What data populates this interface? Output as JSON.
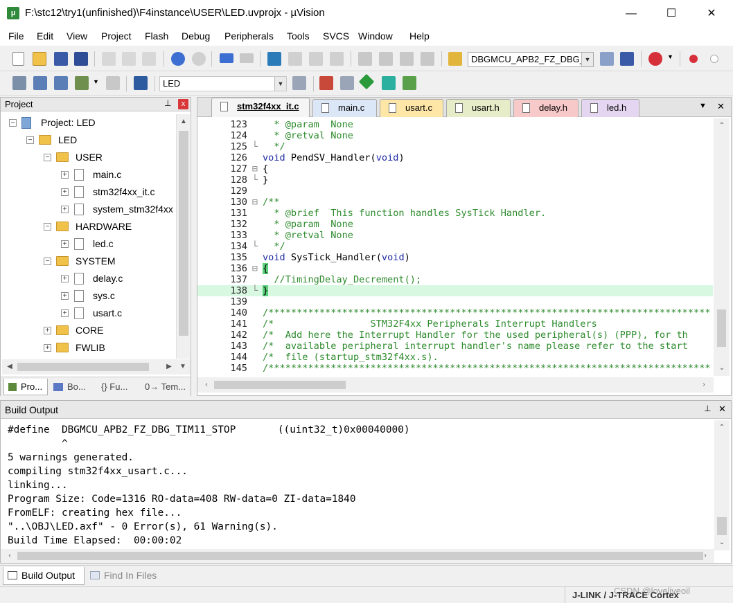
{
  "window": {
    "title": "F:\\stc12\\try1(unfinished)\\F4instance\\USER\\LED.uvprojx - µVision",
    "app_icon": "µ",
    "minimize": "—",
    "maximize": "☐",
    "close": "✕"
  },
  "menu": [
    "File",
    "Edit",
    "View",
    "Project",
    "Flash",
    "Debug",
    "Peripherals",
    "Tools",
    "SVCS",
    "Window",
    "Help"
  ],
  "toolbar1": {
    "find_combo_value": "DBGMCU_APB2_FZ_DBG_"
  },
  "toolbar2": {
    "target_combo_value": "LED"
  },
  "project_panel": {
    "title": "Project",
    "pin": "⊥",
    "close": "x",
    "tree": [
      {
        "label": "Project: LED",
        "expander": "−"
      },
      {
        "label": "LED",
        "expander": "−"
      },
      {
        "label": "USER",
        "expander": "−"
      },
      {
        "label": "main.c",
        "expander": "+"
      },
      {
        "label": "stm32f4xx_it.c",
        "expander": "+"
      },
      {
        "label": "system_stm32f4xx",
        "expander": "+"
      },
      {
        "label": "HARDWARE",
        "expander": "−"
      },
      {
        "label": "led.c",
        "expander": "+"
      },
      {
        "label": "SYSTEM",
        "expander": "−"
      },
      {
        "label": "delay.c",
        "expander": "+"
      },
      {
        "label": "sys.c",
        "expander": "+"
      },
      {
        "label": "usart.c",
        "expander": "+"
      },
      {
        "label": "CORE",
        "expander": "+"
      },
      {
        "label": "FWLIB",
        "expander": "+"
      }
    ],
    "bottom_tabs": [
      "Pro...",
      "Bo...",
      "{} Fu...",
      "0→ Tem..."
    ]
  },
  "editor": {
    "tabs": [
      {
        "label": "stm32f4xx_it.c",
        "color": "#f5f5f5",
        "active": true
      },
      {
        "label": "main.c",
        "color": "#dbe6f7"
      },
      {
        "label": "usart.c",
        "color": "#fde6a6"
      },
      {
        "label": "usart.h",
        "color": "#e7ecc8"
      },
      {
        "label": "delay.h",
        "color": "#f7c9c9"
      },
      {
        "label": "led.h",
        "color": "#e4d6f0"
      }
    ],
    "tab_menu": "▼",
    "tab_close": "✕",
    "lines": [
      {
        "n": "123",
        "fold": "",
        "text": "  * @param  None",
        "cls": "cm"
      },
      {
        "n": "124",
        "fold": "",
        "text": "  * @retval None",
        "cls": "cm"
      },
      {
        "n": "125",
        "fold": "└",
        "text": "  */",
        "cls": "cm"
      },
      {
        "n": "126",
        "fold": "",
        "text": "void PendSV_Handler(void)",
        "cls": ""
      },
      {
        "n": "127",
        "fold": "⊟",
        "text": "{",
        "cls": ""
      },
      {
        "n": "128",
        "fold": "└",
        "text": "}",
        "cls": ""
      },
      {
        "n": "129",
        "fold": "",
        "text": "",
        "cls": ""
      },
      {
        "n": "130",
        "fold": "⊟",
        "text": "/**",
        "cls": "cm"
      },
      {
        "n": "131",
        "fold": "",
        "text": "  * @brief  This function handles SysTick Handler.",
        "cls": "cm"
      },
      {
        "n": "132",
        "fold": "",
        "text": "  * @param  None",
        "cls": "cm"
      },
      {
        "n": "133",
        "fold": "",
        "text": "  * @retval None",
        "cls": "cm"
      },
      {
        "n": "134",
        "fold": "└",
        "text": "  */",
        "cls": "cm"
      },
      {
        "n": "135",
        "fold": "",
        "text": "void SysTick_Handler(void)",
        "cls": ""
      },
      {
        "n": "136",
        "fold": "⊟",
        "text": "{",
        "cls": ""
      },
      {
        "n": "137",
        "fold": "",
        "text": "  //TimingDelay_Decrement();",
        "cls": "cm"
      },
      {
        "n": "138",
        "fold": "└",
        "text": "}",
        "cls": "",
        "highlight": true
      },
      {
        "n": "139",
        "fold": "",
        "text": "",
        "cls": ""
      },
      {
        "n": "140",
        "fold": "",
        "text": "/******************************************************************************",
        "cls": "cm"
      },
      {
        "n": "141",
        "fold": "",
        "text": "/*                 STM32F4xx Peripherals Interrupt Handlers",
        "cls": "cm"
      },
      {
        "n": "142",
        "fold": "",
        "text": "/*  Add here the Interrupt Handler for the used peripheral(s) (PPP), for th",
        "cls": "cm"
      },
      {
        "n": "143",
        "fold": "",
        "text": "/*  available peripheral interrupt handler's name please refer to the start",
        "cls": "cm"
      },
      {
        "n": "144",
        "fold": "",
        "text": "/*  file (startup_stm32f4xx.s).",
        "cls": "cm"
      },
      {
        "n": "145",
        "fold": "",
        "text": "/******************************************************************************",
        "cls": "cm"
      }
    ]
  },
  "build_output": {
    "title": "Build Output",
    "pin": "⊥",
    "close": "✕",
    "text": "#define  DBGMCU_APB2_FZ_DBG_TIM11_STOP       ((uint32_t)0x00040000)\n         ^\n5 warnings generated.\ncompiling stm32f4xx_usart.c...\nlinking...\nProgram Size: Code=1316 RO-data=408 RW-data=0 ZI-data=1840\nFromELF: creating hex file...\n\"..\\OBJ\\LED.axf\" - 0 Error(s), 61 Warning(s).\nBuild Time Elapsed:  00:00:02"
  },
  "bottom_tabs": [
    "Build Output",
    "Find In Files"
  ],
  "status": {
    "debugger": "J-LINK / J-TRACE Cortex",
    "watermark": "CSDN @loveliveoil"
  }
}
